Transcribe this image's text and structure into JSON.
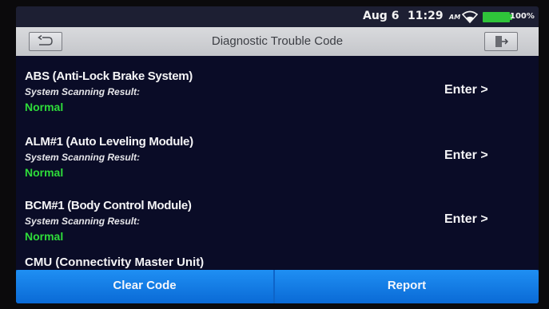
{
  "status_bar": {
    "date": "Aug 6",
    "time": "11:29",
    "ampm": "AM",
    "wifi_icon": "wifi-icon",
    "battery_icon": "battery-icon",
    "battery": "100%"
  },
  "title_bar": {
    "title": "Diagnostic Trouble Code",
    "back_icon": "back-arrow-icon",
    "exit_icon": "exit-icon"
  },
  "systems": [
    {
      "name": "ABS (Anti-Lock Brake System)",
      "result_label": "System Scanning Result:",
      "result": "Normal",
      "action": "Enter >"
    },
    {
      "name": "ALM#1 (Auto Leveling Module)",
      "result_label": "System Scanning Result:",
      "result": "Normal",
      "action": "Enter >"
    },
    {
      "name": "BCM#1 (Body Control Module)",
      "result_label": "System Scanning Result:",
      "result": "Normal",
      "action": "Enter >"
    },
    {
      "name": "CMU (Connectivity Master Unit)"
    }
  ],
  "bottom_bar": {
    "clear_label": "Clear Code",
    "report_label": "Report"
  },
  "colors": {
    "background": "#0a0c27",
    "normal_status": "#2edc3a",
    "button_blue": "#0a6ad6",
    "battery": "#2fc43a"
  }
}
